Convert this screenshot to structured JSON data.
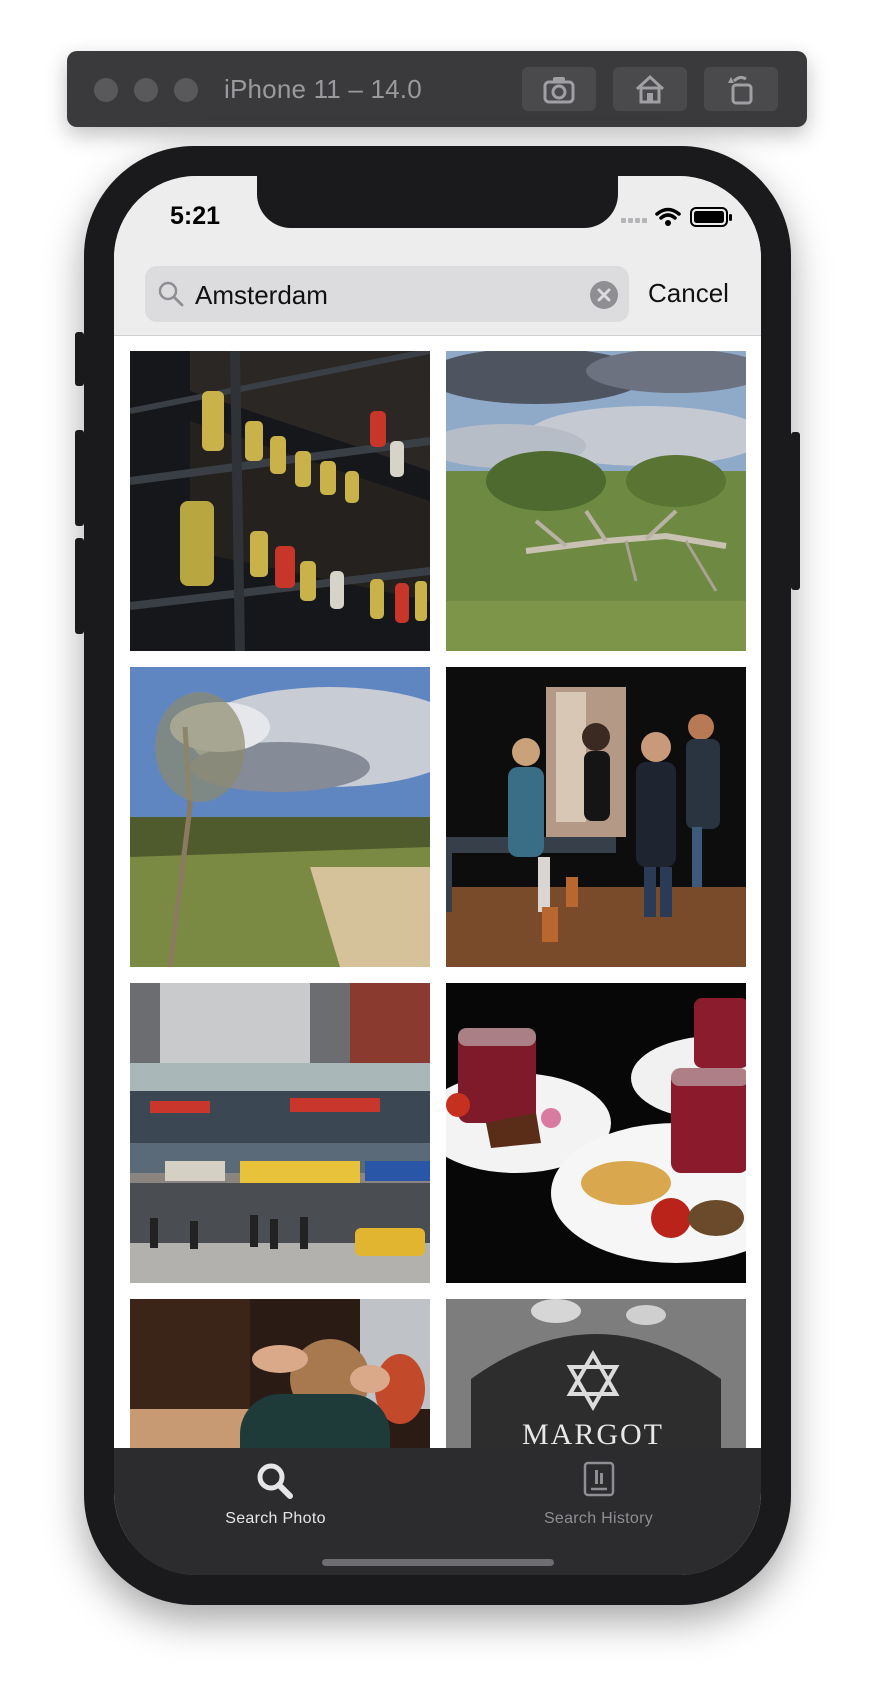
{
  "simulator": {
    "title": "iPhone 11 – 14.0",
    "buttons": [
      "screenshot-icon",
      "home-icon",
      "rotate-icon"
    ]
  },
  "status_bar": {
    "time": "5:21",
    "icons": [
      "cellular-icon",
      "wifi-icon",
      "battery-icon"
    ]
  },
  "search": {
    "query": "Amsterdam",
    "cancel_label": "Cancel",
    "icon": "search-icon"
  },
  "photos": [
    {
      "name": "bottles-shelf-photo"
    },
    {
      "name": "fallen-tree-landscape-photo"
    },
    {
      "name": "dunes-landscape-photo"
    },
    {
      "name": "people-standing-room-photo"
    },
    {
      "name": "street-storefront-photo"
    },
    {
      "name": "drinks-and-plates-photo"
    },
    {
      "name": "person-hands-on-head-photo"
    },
    {
      "name": "gravestone-photo",
      "visible_text": "MARGOT"
    }
  ],
  "tabbar": {
    "tabs": [
      {
        "label": "Search Photo",
        "icon": "search-icon",
        "active": true
      },
      {
        "label": "Search History",
        "icon": "book-icon",
        "active": false
      }
    ],
    "colors": {
      "active": "#e6e6e8",
      "inactive": "#8e8e93",
      "background": "#2c2c2e"
    }
  }
}
